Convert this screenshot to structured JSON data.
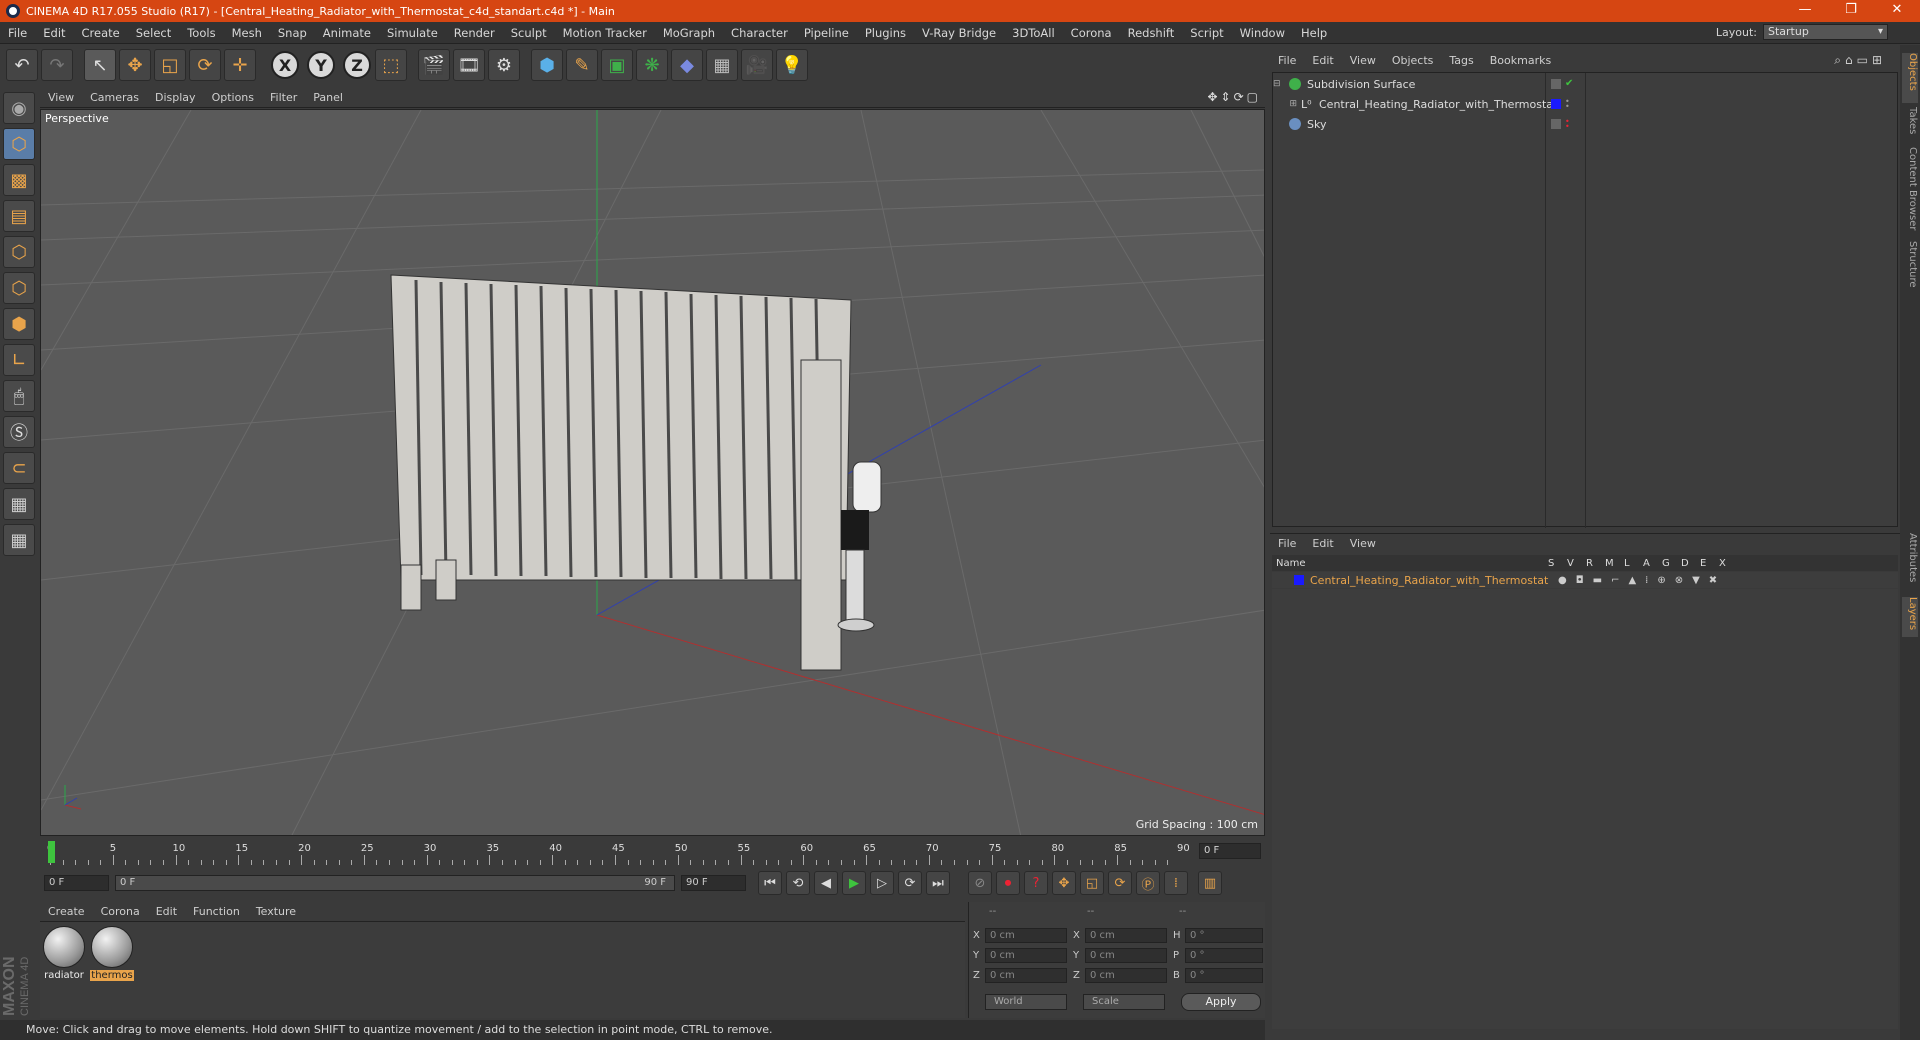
{
  "window": {
    "title": "CINEMA 4D R17.055 Studio (R17) - [Central_Heating_Radiator_with_Thermostat_c4d_standart.c4d *] - Main",
    "controls": [
      "—",
      "❐",
      "✕"
    ]
  },
  "menubar": {
    "items": [
      "File",
      "Edit",
      "Create",
      "Select",
      "Tools",
      "Mesh",
      "Snap",
      "Animate",
      "Simulate",
      "Render",
      "Sculpt",
      "Motion Tracker",
      "MoGraph",
      "Character",
      "Pipeline",
      "Plugins",
      "V-Ray Bridge",
      "3DToAll",
      "Corona",
      "Redshift",
      "Script",
      "Window",
      "Help"
    ],
    "layout_label": "Layout:",
    "layout_value": "Startup"
  },
  "toolbar": {
    "axes": [
      "X",
      "Y",
      "Z"
    ]
  },
  "viewport": {
    "menu": [
      "View",
      "Cameras",
      "Display",
      "Options",
      "Filter",
      "Panel"
    ],
    "camera_label": "Perspective",
    "grid_spacing": "Grid Spacing : 100 cm"
  },
  "timeline": {
    "ticks": [
      "0",
      "5",
      "10",
      "15",
      "20",
      "25",
      "30",
      "35",
      "40",
      "45",
      "50",
      "55",
      "60",
      "65",
      "70",
      "75",
      "80",
      "85",
      "90"
    ],
    "current_frame": "0 F"
  },
  "playbar": {
    "start": "0 F",
    "range_start": "0 F",
    "range_end": "90 F",
    "end": "90 F"
  },
  "materials": {
    "menu": [
      "Create",
      "Corona",
      "Edit",
      "Function",
      "Texture"
    ],
    "items": [
      {
        "name": "radiator",
        "selected": false
      },
      {
        "name": "thermos",
        "selected": true
      }
    ]
  },
  "coords": {
    "headers": [
      "--",
      "--",
      "--"
    ],
    "rows": [
      {
        "a": "X",
        "av": "0 cm",
        "b": "X",
        "bv": "0 cm",
        "c": "H",
        "cv": "0 °"
      },
      {
        "a": "Y",
        "av": "0 cm",
        "b": "Y",
        "bv": "0 cm",
        "c": "P",
        "cv": "0 °"
      },
      {
        "a": "Z",
        "av": "0 cm",
        "b": "Z",
        "bv": "0 cm",
        "c": "B",
        "cv": "0 °"
      }
    ],
    "mode": "World",
    "transform": "Scale",
    "apply": "Apply"
  },
  "status": "Move: Click and drag to move elements. Hold down SHIFT to quantize movement / add to the selection in point mode, CTRL to remove.",
  "objects": {
    "menu": [
      "File",
      "Edit",
      "View",
      "Objects",
      "Tags",
      "Bookmarks"
    ],
    "items": [
      {
        "name": "Subdivision Surface",
        "color": "#3fb04a"
      },
      {
        "name": "Central_Heating_Radiator_with_Thermostat",
        "color": "#cfcfcf"
      },
      {
        "name": "Sky",
        "color": "#6a8fc0"
      }
    ]
  },
  "layers": {
    "menu": [
      "File",
      "Edit",
      "View"
    ],
    "header_name": "Name",
    "header_flags": [
      "S",
      "V",
      "R",
      "M",
      "L",
      "A",
      "G",
      "D",
      "E",
      "X"
    ],
    "row_name": "Central_Heating_Radiator_with_Thermostat",
    "row_color": "#1a1aff"
  },
  "right_tabs": [
    "Objects",
    "Takes",
    "Content Browser",
    "Structure",
    "Attributes",
    "Layers"
  ],
  "logo": {
    "brand": "MAXON",
    "product": "CINEMA 4D"
  }
}
